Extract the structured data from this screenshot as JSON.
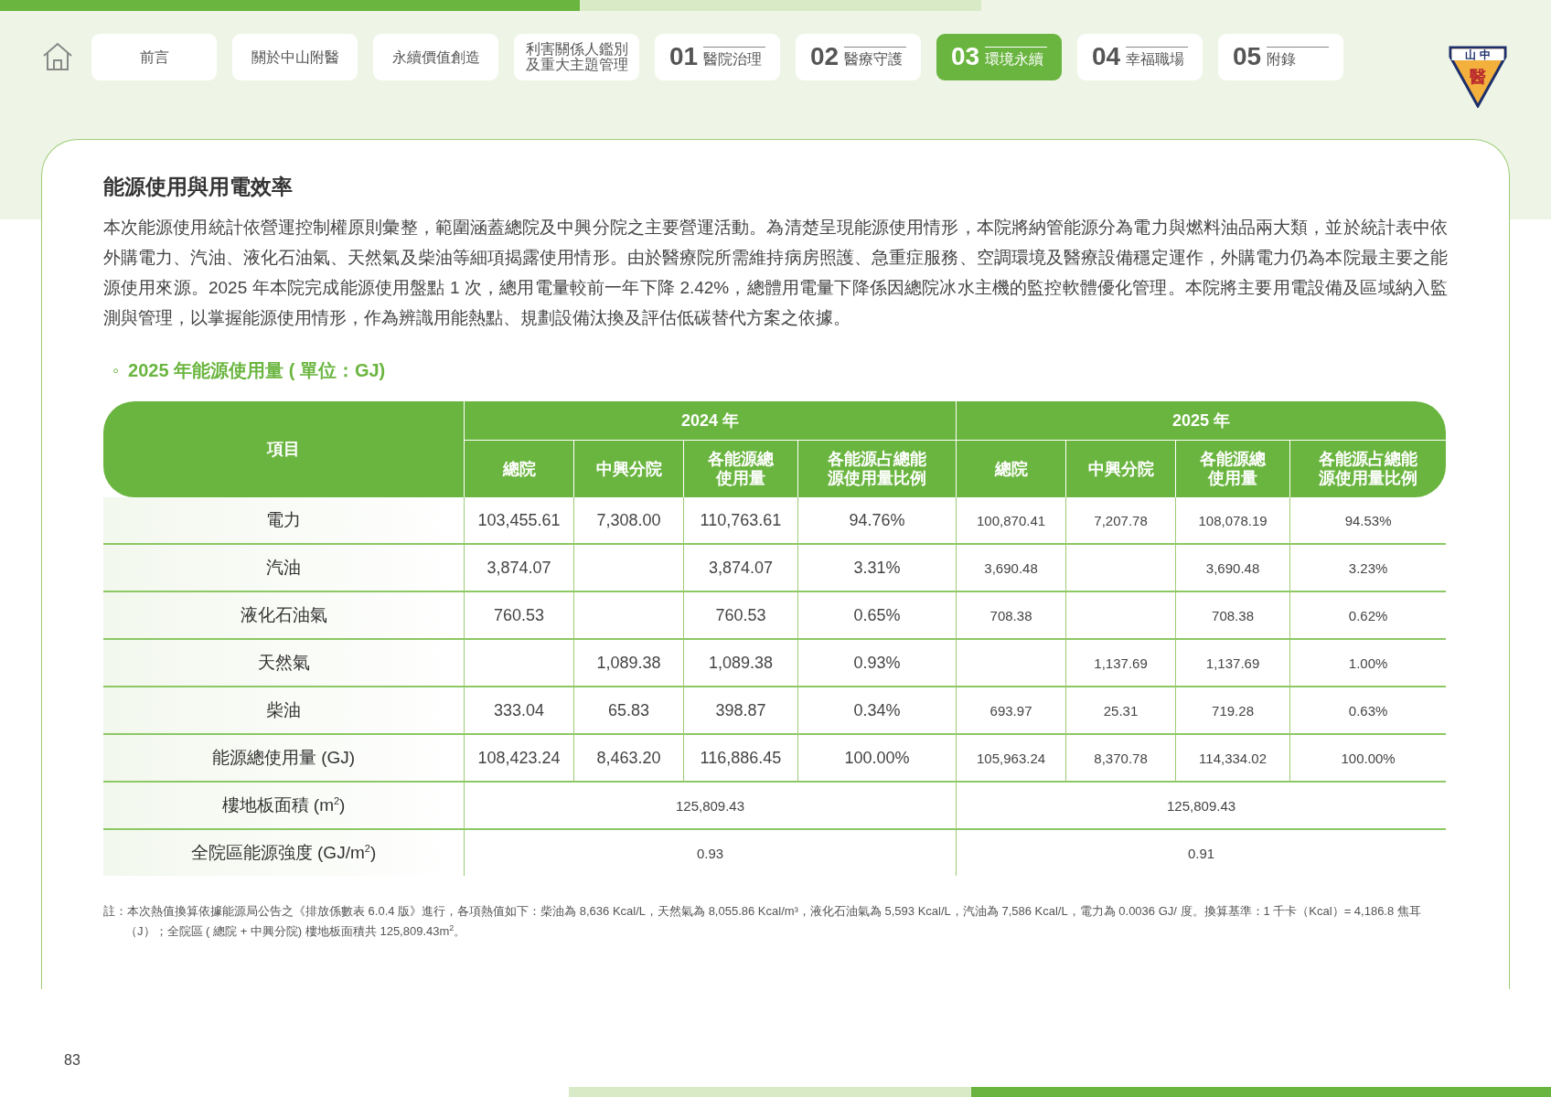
{
  "nav": {
    "items": [
      {
        "kind": "plain",
        "label": "前言",
        "selected": false
      },
      {
        "kind": "plain",
        "label": "關於中山附醫",
        "selected": false
      },
      {
        "kind": "plain",
        "label": "永續價值創造",
        "selected": false
      },
      {
        "kind": "plain",
        "label": "利害關係人鑑別及重大主題管理",
        "selected": false
      },
      {
        "kind": "chapter",
        "number": "01",
        "label": "醫院治理",
        "selected": false
      },
      {
        "kind": "chapter",
        "number": "02",
        "label": "醫療守護",
        "selected": false
      },
      {
        "kind": "chapter",
        "number": "03",
        "label": "環境永續",
        "selected": true
      },
      {
        "kind": "chapter",
        "number": "04",
        "label": "幸福職場",
        "selected": false
      },
      {
        "kind": "chapter",
        "number": "05",
        "label": "附錄",
        "selected": false
      }
    ],
    "logo": {
      "top": "山 中",
      "mark": "醫"
    }
  },
  "section": {
    "title": "能源使用與用電效率",
    "paragraph": "本次能源使用統計依營運控制權原則彙整，範圍涵蓋總院及中興分院之主要營運活動。為清楚呈現能源使用情形，本院將納管能源分為電力與燃料油品兩大類，並於統計表中依外購電力、汽油、液化石油氣、天然氣及柴油等細項揭露使用情形。由於醫療院所需維持病房照護、急重症服務、空調環境及醫療設備穩定運作，外購電力仍為本院最主要之能源使用來源。2025 年本院完成能源使用盤點 1 次，總用電量較前一年下降 2.42%，總體用電量下降係因總院冰水主機的監控軟體優化管理。本院將主要用電設備及區域納入監測與管理，以掌握能源使用情形，作為辨識用能熱點、規劃設備汰換及評估低碳替代方案之依據。",
    "table_bullet": "◦",
    "table_title": "2025 年能源使用量 ( 單位：GJ)"
  },
  "table": {
    "item_header": "項目",
    "groups": [
      {
        "label": "2024 年",
        "columns": [
          "總院",
          "中興分院",
          "各能源總使用量",
          "各能源占總能源使用量比例"
        ]
      },
      {
        "label": "2025 年",
        "columns": [
          "總院",
          "中興分院",
          "各能源總使用量",
          "各能源占總能源使用量比例"
        ]
      }
    ],
    "rows": [
      {
        "kind": "split",
        "label": "電力",
        "cells": [
          "103,455.61",
          "7,308.00",
          "110,763.61",
          "94.76%",
          "100,870.41",
          "7,207.78",
          "108,078.19",
          "94.53%"
        ]
      },
      {
        "kind": "split",
        "label": "汽油",
        "cells": [
          "3,874.07",
          null,
          "3,874.07",
          "3.31%",
          "3,690.48",
          null,
          "3,690.48",
          "3.23%"
        ]
      },
      {
        "kind": "split",
        "label": "液化石油氣",
        "cells": [
          "760.53",
          null,
          "760.53",
          "0.65%",
          "708.38",
          null,
          "708.38",
          "0.62%"
        ]
      },
      {
        "kind": "split",
        "label": "天然氣",
        "cells": [
          null,
          "1,089.38",
          "1,089.38",
          "0.93%",
          null,
          "1,137.69",
          "1,137.69",
          "1.00%"
        ]
      },
      {
        "kind": "split",
        "label": "柴油",
        "cells": [
          "333.04",
          "65.83",
          "398.87",
          "0.34%",
          "693.97",
          "25.31",
          "719.28",
          "0.63%"
        ]
      },
      {
        "kind": "split",
        "label": "能源總使用量 (GJ)",
        "cells": [
          "108,423.24",
          "8,463.20",
          "116,886.45",
          "100.00%",
          "105,963.24",
          "8,370.78",
          "114,334.02",
          "100.00%"
        ]
      },
      {
        "kind": "merged",
        "label": "樓地板面積 (m$^{2}$)",
        "cells": [
          {
            "text": "125,809.43",
            "colspan": 4
          },
          {
            "text": "125,809.43",
            "colspan": 4
          }
        ]
      },
      {
        "kind": "merged",
        "label": "全院區能源強度 (GJ/m$^{2}$)",
        "cells": [
          {
            "text": "0.93",
            "colspan": 4
          },
          {
            "text": "0.91",
            "colspan": 4
          }
        ]
      }
    ]
  },
  "footnote": "註：本次熱值換算依據能源局公告之《排放係數表 6.0.4 版》進行，各項熱值如下：柴油為 8,636 Kcal/L，天然氣為 8,055.86 Kcal/m³，液化石油氣為 5,593 Kcal/L，汽油為 7,586 Kcal/L，電力為 0.0036 GJ/ 度。換算基準：1 千卡（Kcal）= 4,186.8 焦耳（J）；全院區 ( 總院 + 中興分院) 樓地板面積共 125,809.43m$^{2}$。",
  "page_number": "83"
}
